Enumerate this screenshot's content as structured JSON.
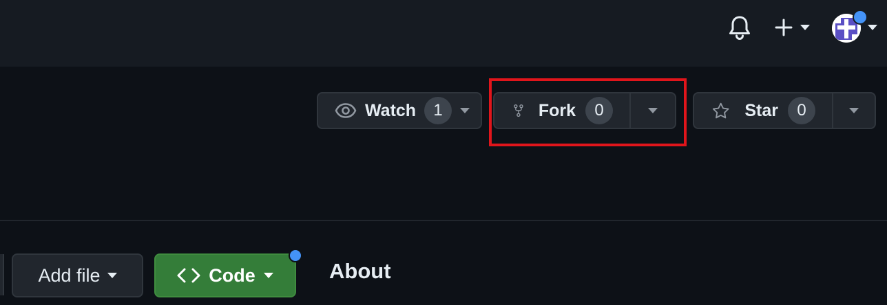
{
  "topbar": {
    "bell_icon": "bell-icon",
    "create_icon": "plus-icon",
    "avatar_icon": "avatar"
  },
  "repo_actions": {
    "watch": {
      "label": "Watch",
      "count": "1",
      "icon": "eye-icon"
    },
    "fork": {
      "label": "Fork",
      "count": "0",
      "icon": "repo-forked-icon"
    },
    "star": {
      "label": "Star",
      "count": "0",
      "icon": "star-icon"
    }
  },
  "toolbar": {
    "add_file_label": "Add file",
    "code_label": "Code",
    "code_icon": "code-icon"
  },
  "sidebar": {
    "about_heading": "About"
  },
  "colors": {
    "highlight": "#e0151b",
    "code_button": "#347d39",
    "notification_dot": "#4493f8"
  }
}
